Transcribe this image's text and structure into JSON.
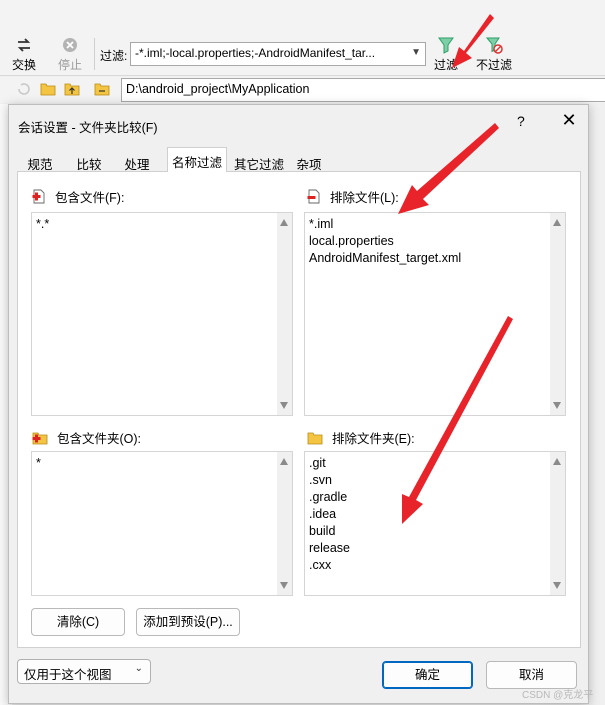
{
  "toolbar": {
    "swap_label": "交换",
    "stop_label": "停止",
    "filter_label": "过滤:",
    "filter_value": "-*.iml;-local.properties;-AndroidManifest_tar...",
    "filter_button_label": "过滤",
    "no_filter_button_label": "不过滤"
  },
  "path": {
    "value": "D:\\android_project\\MyApplication"
  },
  "dialog": {
    "title": "会话设置 - 文件夹比较(F)",
    "help_label": "?",
    "close_label": "✕",
    "tabs": [
      {
        "label": "规范"
      },
      {
        "label": "比较"
      },
      {
        "label": "处理"
      },
      {
        "label": "名称过滤",
        "active": true
      },
      {
        "label": "其它过滤"
      },
      {
        "label": "杂项"
      }
    ],
    "include_files": {
      "label": "包含文件(F):",
      "items": [
        "*.*"
      ]
    },
    "exclude_files": {
      "label": "排除文件(L):",
      "items": [
        "*.iml",
        "local.properties",
        "AndroidManifest_target.xml"
      ]
    },
    "include_folders": {
      "label": "包含文件夹(O):",
      "items": [
        "*"
      ]
    },
    "exclude_folders": {
      "label": "排除文件夹(E):",
      "items": [
        ".git",
        ".svn",
        ".gradle",
        ".idea",
        "build",
        "release",
        ".cxx"
      ]
    },
    "clear_label": "清除(C)",
    "add_preset_label": "添加到预设(P)...",
    "scope_select": "仅用于这个视图",
    "ok_label": "确定",
    "cancel_label": "取消"
  },
  "watermark": "CSDN @克龙平",
  "colors": {
    "accent": "#0067c0",
    "annotation_arrow": "#e8232a",
    "filter_icon": "#2e9e6a"
  }
}
